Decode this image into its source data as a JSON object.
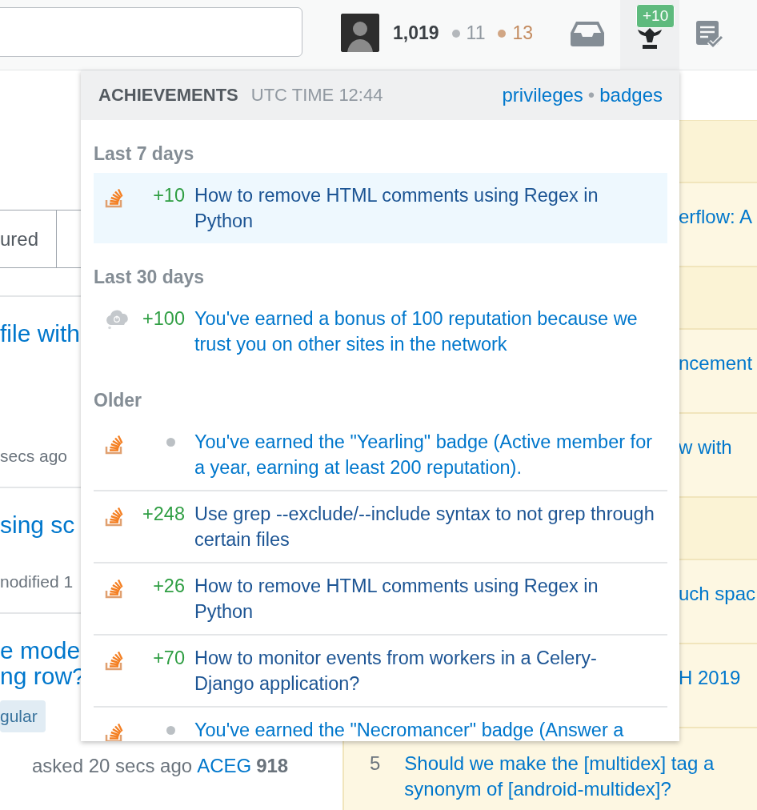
{
  "topbar": {
    "reputation": "1,019",
    "silver_badges": "11",
    "bronze_badges": "13",
    "achievements_count": "+10"
  },
  "background_left": {
    "tabs": [
      "ured"
    ],
    "questions": [
      {
        "title_lines": [
          "file with"
        ],
        "meta": "secs ago"
      },
      {
        "title_lines": [
          "sing sc"
        ],
        "meta": "nodified 1"
      },
      {
        "title_lines": [
          "e mode",
          "ng row?"
        ],
        "tags": [
          "gular"
        ],
        "asked": "asked 20 secs ago",
        "user": "ACEG",
        "rep": "918"
      }
    ]
  },
  "background_right": [
    {
      "kind": "header"
    },
    {
      "kind": "link",
      "text": "erflow: A"
    },
    {
      "kind": "header"
    },
    {
      "kind": "link",
      "text": "ncement"
    },
    {
      "kind": "link",
      "text": "w with"
    },
    {
      "kind": "header"
    },
    {
      "kind": "link",
      "text": "uch spac"
    },
    {
      "kind": "link",
      "text": "H 2019"
    },
    {
      "kind": "numbered",
      "number": "5",
      "text": "Should we make the [multidex] tag a synonym of [android-multidex]?"
    }
  ],
  "achievements": {
    "title": "ACHIEVEMENTS",
    "time": "UTC TIME 12:44",
    "links": [
      "privileges",
      "badges"
    ],
    "separator": "•",
    "sections": [
      {
        "heading": "Last 7 days",
        "items": [
          {
            "kind": "post",
            "amount": "+10",
            "text": "How to remove HTML comments using Regex in Python",
            "unread": true
          }
        ]
      },
      {
        "heading": "Last 30 days",
        "items": [
          {
            "kind": "bonus",
            "amount": "+100",
            "text": "You've earned a bonus of 100 reputation because we trust you on other sites in the network",
            "unread": false
          }
        ]
      },
      {
        "heading": "Older",
        "items": [
          {
            "kind": "badge",
            "text": "You've earned the \"Yearling\" badge (Active member for a year, earning at least 200 reputation).",
            "unread": false
          },
          {
            "kind": "post",
            "amount": "+248",
            "text": "Use grep --exclude/--include syntax to not grep through certain files",
            "unread": false
          },
          {
            "kind": "post",
            "amount": "+26",
            "text": "How to remove HTML comments using Regex in Python",
            "unread": false
          },
          {
            "kind": "post",
            "amount": "+70",
            "text": "How to monitor events from workers in a Celery-Django application?",
            "unread": false
          },
          {
            "kind": "badge",
            "text": "You've earned the \"Necromancer\" badge (Answer a",
            "unread": false
          }
        ]
      }
    ]
  }
}
